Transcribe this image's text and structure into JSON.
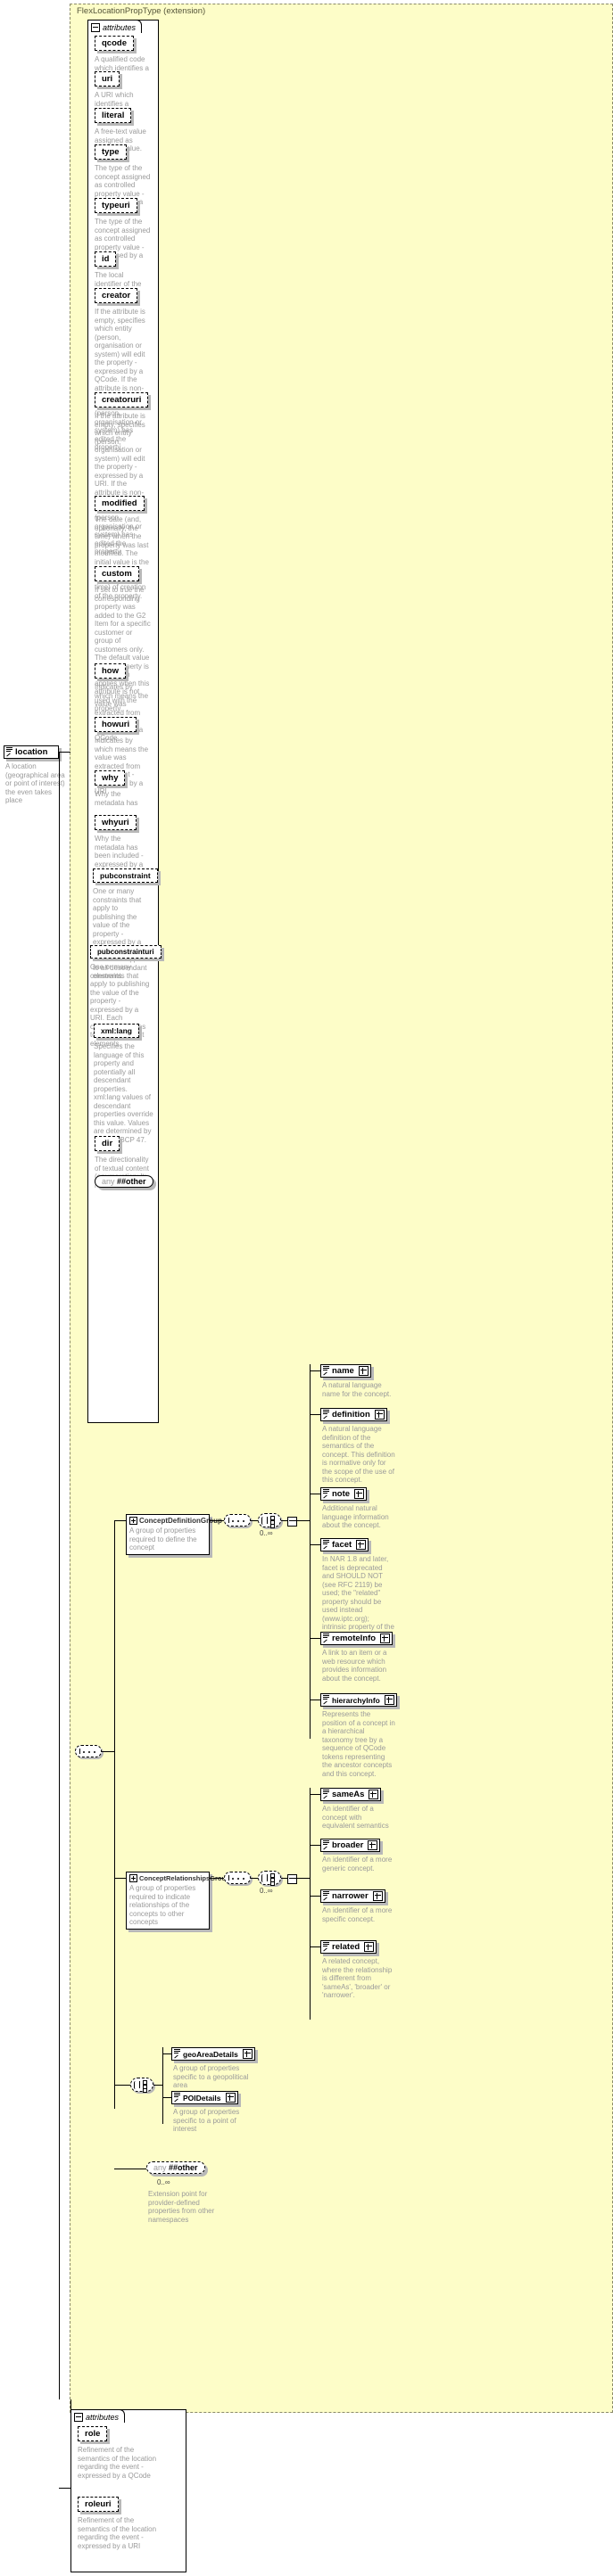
{
  "diagram": {
    "type": "xsd-schema-documentation",
    "root_element": {
      "name": "location",
      "description": "A location (geographical area or point of interest) the even takes place"
    },
    "extension": {
      "title": "FlexLocationPropType (extension)"
    },
    "attributes_tab_label": "attributes",
    "attributes": [
      {
        "name": "qcode",
        "description": "A qualified code which identifies a concept."
      },
      {
        "name": "uri",
        "description": "A URI which identifies a concept."
      },
      {
        "name": "literal",
        "description": "A free-text value assigned as property value."
      },
      {
        "name": "type",
        "description": "The type of the concept assigned as controlled property value - expressed by a QCode"
      },
      {
        "name": "typeuri",
        "description": "The type of the concept assigned as controlled property value - expressed by a URI"
      },
      {
        "name": "id",
        "description": "The local identifier of the property."
      },
      {
        "name": "creator",
        "description": "If the attribute is empty, specifies which entity (person, organisation or system) will edit the property - expressed by a QCode. If the attribute is non-empty, specifies which entity (person, organisation or system) has edited the property."
      },
      {
        "name": "creatoruri",
        "description": "If the attribute is empty, specifies which entity (person, organisation or system) will edit the property - expressed by a URI. If the attribute is non-empty, specifies which entity (person, organisation or system) has edited the property."
      },
      {
        "name": "modified",
        "description": "The date (and, optionally, the time) when the property was last modified. The initial value is the date (and, optionally, the time) of creation of the property."
      },
      {
        "name": "custom",
        "description": "If set to true the corresponding property was added to the G2 Item for a specific customer or group of customers only. The default value of this property is false which applies when this attribute is not used with the property."
      },
      {
        "name": "how",
        "description": "Indicates by which means the value was extracted from the content - expressed by a QCode"
      },
      {
        "name": "howuri",
        "description": "Indicates by which means the value was extracted from the content - expressed by a URI"
      },
      {
        "name": "why",
        "description": "Why the metadata has been included - expressed by a QCode"
      },
      {
        "name": "whyuri",
        "description": "Why the metadata has been included - expressed by a URI"
      },
      {
        "name": "pubconstraint",
        "description": "One or many constraints that apply to publishing the value of the property - expressed by a QCode. Each constraint applies to all descendant elements."
      },
      {
        "name": "pubconstrainturi",
        "description": "One or many constraints that apply to publishing the value of the property - expressed by a URI. Each constraint applies to all descendant elements."
      },
      {
        "name": "xml:lang",
        "description": "Specifies the language of this property and potentially all descendant properties. xml:lang values of descendant properties override this value. Values are determined by Internet BCP 47."
      },
      {
        "name": "dir",
        "description": "The directionality of textual content (enumeration: ltr, rtl)"
      }
    ],
    "any_other": {
      "prefix": "any",
      "label": "##other"
    },
    "groups": [
      {
        "name": "ConceptDefinitionGroup",
        "description": "A group of properties required to define the concept",
        "occurrence": "0..∞",
        "children": [
          {
            "name": "name",
            "description": "A natural language name for the concept.",
            "expander": "plus"
          },
          {
            "name": "definition",
            "description": "A natural language definition of the semantics of the concept. This definition is normative only for the scope of the use of this concept.",
            "expander": "plus"
          },
          {
            "name": "note",
            "description": "Additional natural language information about the concept.",
            "expander": "plus"
          },
          {
            "name": "facet",
            "description": "In NAR 1.8 and later, facet is deprecated and SHOULD NOT (see RFC 2119) be used; the \"related\" property should be used instead (www.iptc.org); intrinsic property of the concept.",
            "expander": "plus"
          },
          {
            "name": "remoteInfo",
            "description": "A link to an item or a web resource which provides information about the concept.",
            "expander": "plus"
          },
          {
            "name": "hierarchyInfo",
            "description": "Represents the position of a concept in a hierarchical taxonomy tree by a sequence of QCode tokens representing the ancestor concepts and this concept.",
            "expander": "plus"
          }
        ]
      },
      {
        "name": "ConceptRelationshipsGroup",
        "description": "A group of properties required to indicate relationships of the concepts to other concepts",
        "occurrence": "0..∞",
        "children": [
          {
            "name": "sameAs",
            "description": "An identifier of a concept with equivalent semantics",
            "expander": "plus"
          },
          {
            "name": "broader",
            "description": "An identifier of a more generic concept.",
            "expander": "plus"
          },
          {
            "name": "narrower",
            "description": "An identifier of a more specific concept.",
            "expander": "plus"
          },
          {
            "name": "related",
            "description": "A related concept, where the relationship is different from 'sameAs', 'broader' or 'narrower'.",
            "expander": "plus"
          }
        ]
      }
    ],
    "detail_nodes": [
      {
        "name": "geoAreaDetails",
        "description": "A group of properties specific to a geopolitical area",
        "expander": "plus"
      },
      {
        "name": "POIDetails",
        "description": "A group of properties specific to a point of interest",
        "expander": "plus"
      }
    ],
    "extension_point": {
      "prefix": "any",
      "label": "##other",
      "occurrence": "0..∞",
      "description": "Extension point for provider-defined properties from other namespaces"
    },
    "bottom_attributes": [
      {
        "name": "role",
        "description": "Refinement of the semantics of the location regarding the event - expressed by a QCode"
      },
      {
        "name": "roleuri",
        "description": "Refinement of the semantics of the location regarding the event - expressed by a URI"
      }
    ],
    "colors": {
      "extension_fill": "#fdfdc8",
      "extension_border": "#8a8a6a",
      "node_shadow": "#b8b8b8",
      "desc_text": "#9a9a9a"
    }
  }
}
